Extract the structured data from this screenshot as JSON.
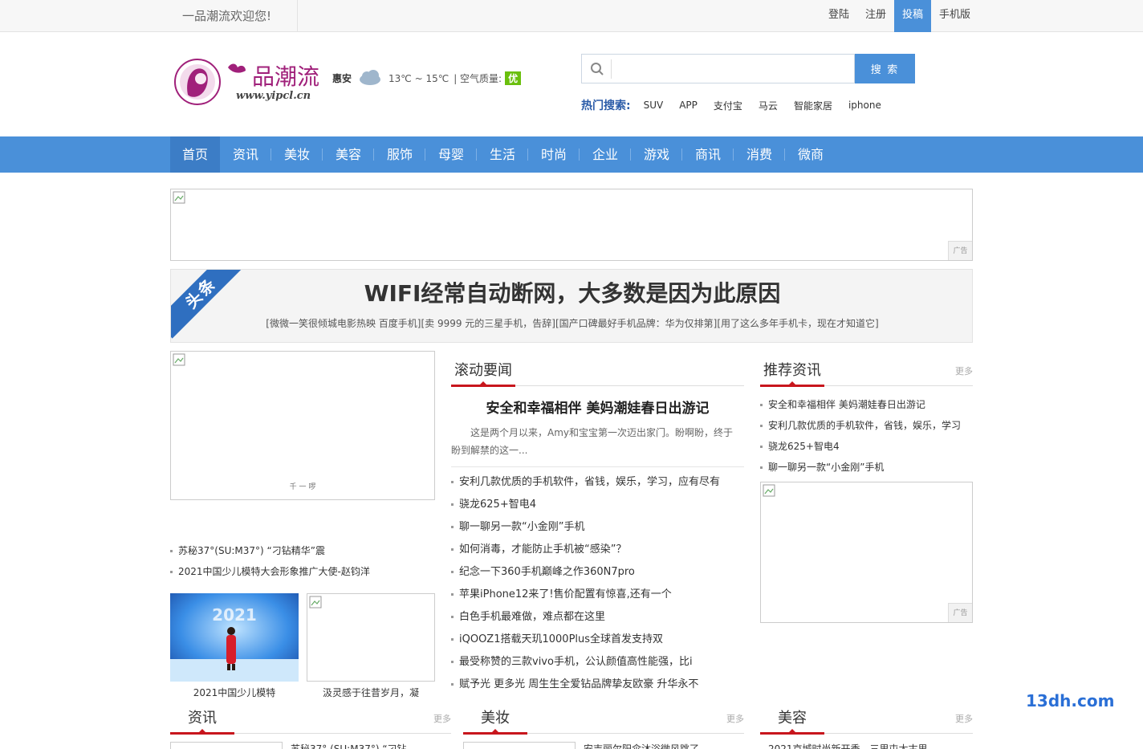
{
  "topbar": {
    "welcome": "一品潮流欢迎您!",
    "links": [
      "登陆",
      "注册",
      "投稿",
      "手机版"
    ]
  },
  "logo": {
    "name": "品潮流",
    "url": "www.yipcl.cn"
  },
  "weather": {
    "city": "惠安",
    "temp": "13℃ ~ 15℃",
    "aq_label": "|  空气质量:",
    "aq_value": "优"
  },
  "search": {
    "placeholder": "",
    "button": "搜 索"
  },
  "hot": {
    "label": "热门搜索:",
    "items": [
      "SUV",
      "APP",
      "支付宝",
      "马云",
      "智能家居",
      "iphone"
    ]
  },
  "nav": [
    "首页",
    "资讯",
    "美妆",
    "美容",
    "服饰",
    "母婴",
    "生活",
    "时尚",
    "企业",
    "游戏",
    "商讯",
    "消费",
    "微商"
  ],
  "ad_tag": "广告",
  "headline": {
    "ribbon": "头条",
    "title": "WIFI经常自动断网，大多数是因为此原因",
    "links": "[微微一笑很倾城电影热映 百度手机][卖 9999 元的三星手机，告辞][国产口碑最好手机品牌：华为仅排第][用了这么多年手机卡，现在才知道它]"
  },
  "left": {
    "big_caption": "千 一 啰",
    "list": [
      "苏秘37°(SU:M37°) “刁钻精华”震",
      "2021中国少儿模特大会形象推广大使-赵钧洋"
    ],
    "thumbs": [
      "2021中国少儿模特",
      "汲灵感于往昔岁月，凝"
    ],
    "thumb_photo_text": "2021"
  },
  "middle": {
    "section": "滚动要闻",
    "top_title": "安全和幸福相伴 美妈潮娃春日出游记",
    "summary": "这是两个月以来，Amy和宝宝第一次迈出家门。盼啊盼，终于盼到解禁的这一...",
    "list": [
      "安利几款优质的手机软件，省钱，娱乐，学习，应有尽有",
      "骁龙625+智电4",
      "聊一聊另一款“小金刚”手机",
      "如何消毒，才能防止手机被“感染”？",
      "纪念一下360手机巅峰之作360N7pro",
      "苹果iPhone12来了!售价配置有惊喜,还有一个",
      "白色手机最难做，难点都在这里",
      "iQOOZ1搭载天玑1000Plus全球首发支持双",
      "最受称赞的三款vivo手机，公认颜值高性能强，比i",
      "赋予光 更多光 周生生全爱钻品牌挚友欧豪 升华永不"
    ]
  },
  "right": {
    "section": "推荐资讯",
    "more": "更多",
    "list": [
      "安全和幸福相伴 美妈潮娃春日出游记",
      "安利几款优质的手机软件，省钱，娱乐，学习",
      "骁龙625+智电4",
      "聊一聊另一款“小金刚”手机"
    ]
  },
  "bottom": {
    "sections": [
      {
        "title": "资讯",
        "more": "更多",
        "first": "苏秘37° (SU:M37°) “刁钻"
      },
      {
        "title": "美妆",
        "more": "更多",
        "first": "安吉丽尔阳伞沐浴微风跳了"
      },
      {
        "title": "美容",
        "more": "更多",
        "first": "2021京城时尚新开季，三里屯太古里"
      }
    ]
  },
  "watermark": "13dh.com",
  "colors": {
    "nav": "#4a90d9",
    "accent_red": "#c8161d",
    "aq_green": "#6abf0d",
    "hot_label": "#2a5ba8"
  }
}
